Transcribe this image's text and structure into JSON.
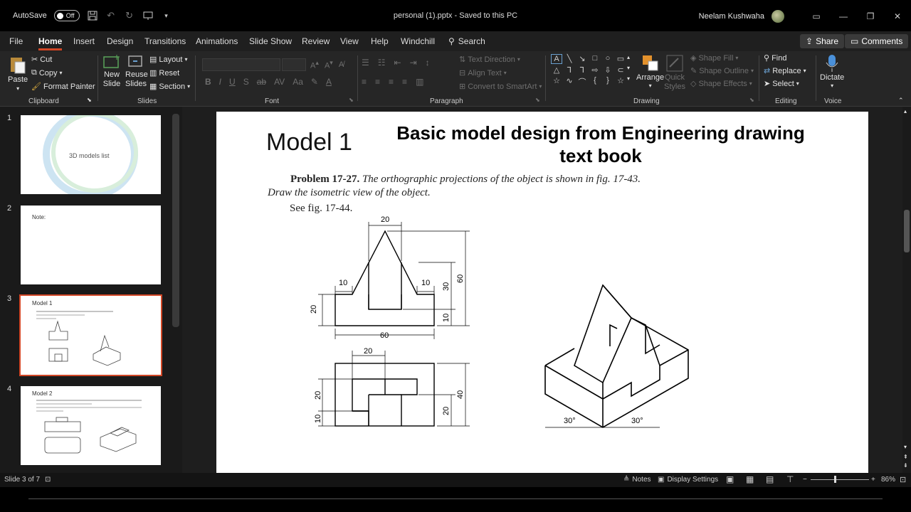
{
  "titlebar": {
    "autosave_label": "AutoSave",
    "autosave_state": "Off",
    "doc_title": "personal (1).pptx  -  Saved to this PC",
    "user_name": "Neelam Kushwaha",
    "min": "—",
    "restore": "❐",
    "close": "✕",
    "ribbon_display": "▭"
  },
  "tabs": [
    "File",
    "Home",
    "Insert",
    "Design",
    "Transitions",
    "Animations",
    "Slide Show",
    "Review",
    "View",
    "Help",
    "Windchill"
  ],
  "active_tab": "Home",
  "search_label": "Search",
  "share_label": "Share",
  "comments_label": "Comments",
  "ribbon": {
    "clipboard": {
      "paste": "Paste",
      "cut": "Cut",
      "copy": "Copy",
      "format_painter": "Format Painter",
      "label": "Clipboard"
    },
    "slides": {
      "new_slide": "New Slide",
      "reuse_slides": "Reuse Slides",
      "layout": "Layout",
      "reset": "Reset",
      "section": "Section",
      "label": "Slides"
    },
    "font": {
      "label": "Font",
      "bold": "B",
      "italic": "I",
      "underline": "U",
      "shadow": "S",
      "strike": "ab"
    },
    "paragraph": {
      "text_direction": "Text Direction",
      "align_text": "Align Text",
      "convert_smartart": "Convert to SmartArt",
      "label": "Paragraph"
    },
    "drawing": {
      "arrange": "Arrange",
      "quick_styles": "Quick Styles",
      "shape_fill": "Shape Fill",
      "shape_outline": "Shape Outline",
      "shape_effects": "Shape Effects",
      "label": "Drawing"
    },
    "editing": {
      "find": "Find",
      "replace": "Replace",
      "select": "Select",
      "label": "Editing"
    },
    "voice": {
      "dictate": "Dictate",
      "label": "Voice"
    }
  },
  "thumbnails": [
    {
      "num": "1",
      "text": "3D models list"
    },
    {
      "num": "2",
      "text": "Note:"
    },
    {
      "num": "3",
      "text": "Model 1"
    },
    {
      "num": "4",
      "text": "Model 2"
    }
  ],
  "slide": {
    "model_title": "Model 1",
    "book_title": "Basic model design from Engineering drawing text book",
    "problem_num": "Problem 17-27.",
    "problem_text_1": "The orthographic projections of the object is shown in fig. 17-43.",
    "problem_text_2": "Draw the isometric view of the object.",
    "see_fig": "See fig. 17-44.",
    "dims": {
      "d20_top": "20",
      "d10_left": "10",
      "d10_right": "10",
      "d60_bottom": "60",
      "d20_left": "20",
      "d30": "30",
      "d60_right": "60",
      "d10_small": "10",
      "d20_plan": "20",
      "d20_plan_left": "20",
      "d10_plan_left": "10",
      "d40": "40",
      "d20_plan_right": "20",
      "angle_left": "30°",
      "angle_right": "30°"
    }
  },
  "status": {
    "slide_count": "Slide 3 of 7",
    "notes": "Notes",
    "display_settings": "Display Settings",
    "zoom": "86%"
  }
}
